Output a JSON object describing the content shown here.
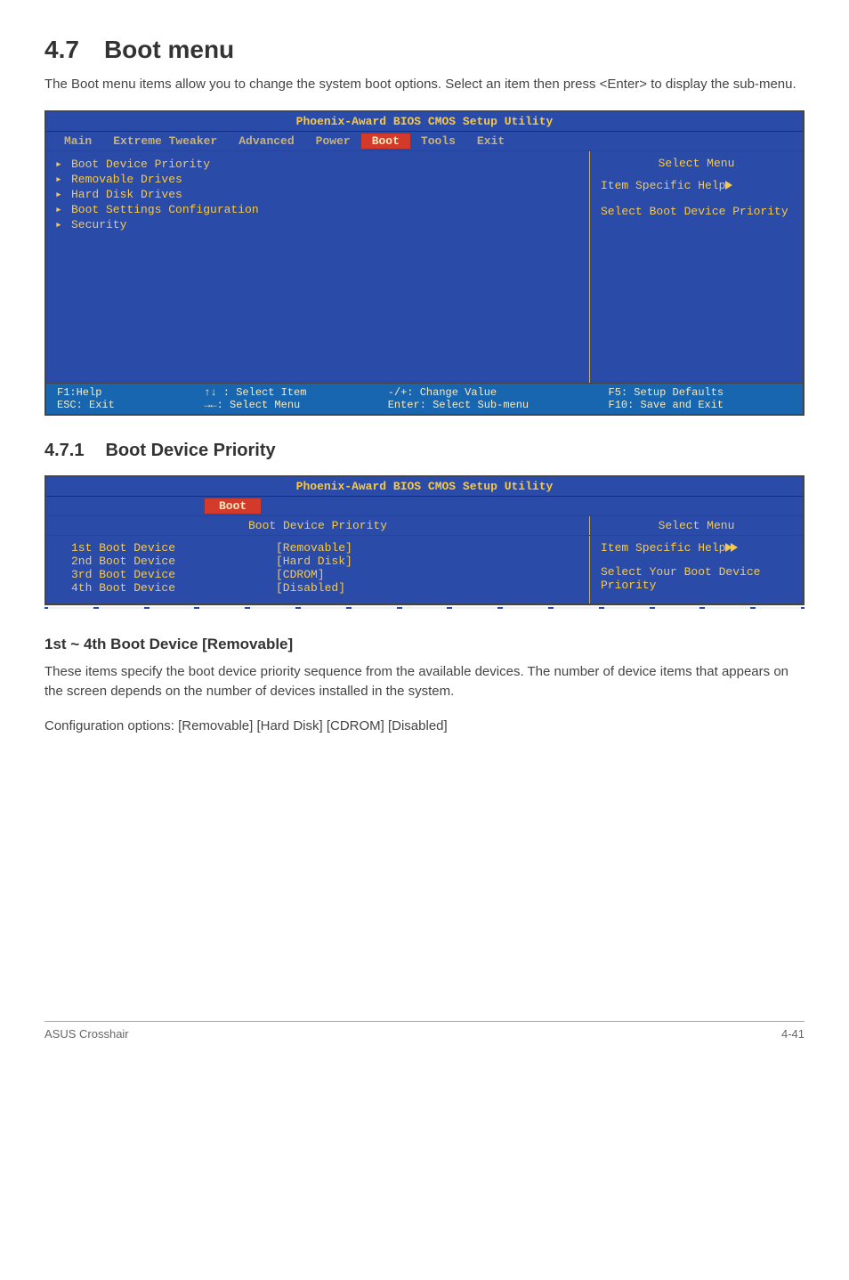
{
  "section": {
    "number": "4.7",
    "title": "Boot menu",
    "intro": "The Boot menu items allow you to change the system boot options. Select an item then press <Enter> to display the sub-menu."
  },
  "bios1": {
    "title": "Phoenix-Award BIOS CMOS Setup Utility",
    "tabs": [
      "Main",
      "Extreme Tweaker",
      "Advanced",
      "Power",
      "Boot",
      "Tools",
      "Exit"
    ],
    "active_tab": "Boot",
    "items": [
      "Boot Device Priority",
      "Removable Drives",
      "Hard Disk Drives",
      "Boot Settings Configuration",
      "Security"
    ],
    "help_title": "Select Menu",
    "help_line1": "Item Specific Help",
    "help_body": "Select Boot Device Priority",
    "legend": {
      "c1a": "F1:Help",
      "c1b": "ESC: Exit",
      "c2a": "↑↓ : Select Item",
      "c2b": "→←: Select Menu",
      "c3a": "-/+: Change Value",
      "c3b": "Enter: Select Sub-menu",
      "c4a": "F5: Setup Defaults",
      "c4b": "F10: Save and Exit"
    }
  },
  "subsection": {
    "number": "4.7.1",
    "title": "Boot Device Priority"
  },
  "bios2": {
    "title": "Phoenix-Award BIOS CMOS Setup Utility",
    "tab": "Boot",
    "left_caption": "Boot Device Priority",
    "right_caption": "Select Menu",
    "rows": [
      {
        "label": "1st Boot Device",
        "value": "[Removable]"
      },
      {
        "label": "2nd Boot Device",
        "value": "[Hard Disk]"
      },
      {
        "label": "3rd Boot Device",
        "value": "[CDROM]"
      },
      {
        "label": "4th Boot Device",
        "value": "[Disabled]"
      }
    ],
    "help_line1": "Item Specific Help",
    "help_body": "Select Your Boot Device Priority"
  },
  "h3": "1st ~ 4th Boot Device [Removable]",
  "para1": "These items specify the boot device priority sequence from the available devices. The number of device items that appears on the screen depends on the number of devices installed in the system.",
  "para2": "Configuration options: [Removable] [Hard Disk] [CDROM] [Disabled]",
  "footer": {
    "left": "ASUS Crosshair",
    "right": "4-41"
  }
}
